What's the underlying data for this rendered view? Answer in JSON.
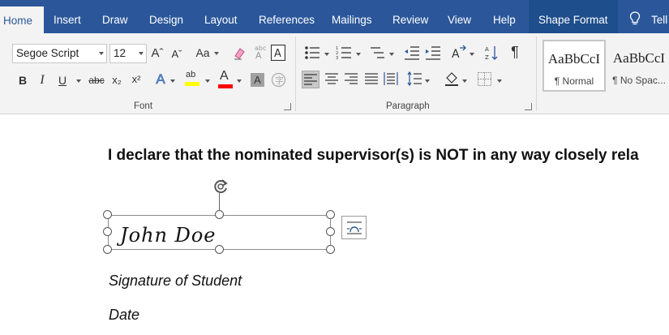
{
  "tabs": [
    {
      "label": "Home"
    },
    {
      "label": "Insert"
    },
    {
      "label": "Draw"
    },
    {
      "label": "Design"
    },
    {
      "label": "Layout"
    },
    {
      "label": "References"
    },
    {
      "label": "Mailings"
    },
    {
      "label": "Review"
    },
    {
      "label": "View"
    },
    {
      "label": "Help"
    },
    {
      "label": "Shape Format"
    },
    {
      "label": "Tell"
    }
  ],
  "font": {
    "name": "Segoe Script",
    "size": "12",
    "group_label": "Font",
    "grow_label": "Aˆ",
    "shrink_label": "Aˇ",
    "case_label": "Aa",
    "bold": "B",
    "italic": "I",
    "underline": "U",
    "strike": "abc",
    "subscript": "x₂",
    "superscript": "x²",
    "effects": "A",
    "highlight": "ab",
    "color": "A",
    "shading": "A"
  },
  "paragraph": {
    "group_label": "Paragraph",
    "pilcrow": "¶"
  },
  "styles": [
    {
      "sample": "AaBbCcI",
      "name": "¶ Normal"
    },
    {
      "sample": "AaBbCcI",
      "name": "¶ No Spac..."
    }
  ],
  "document": {
    "declaration": "I declare that the nominated supervisor(s) is NOT in any way closely rela",
    "signature": "John Doe",
    "signature_label": "Signature of Student",
    "date_label": "Date"
  },
  "colors": {
    "ribbon_blue": "#2b579a",
    "highlight_yellow": "#ffff00",
    "font_red": "#ff0000"
  }
}
